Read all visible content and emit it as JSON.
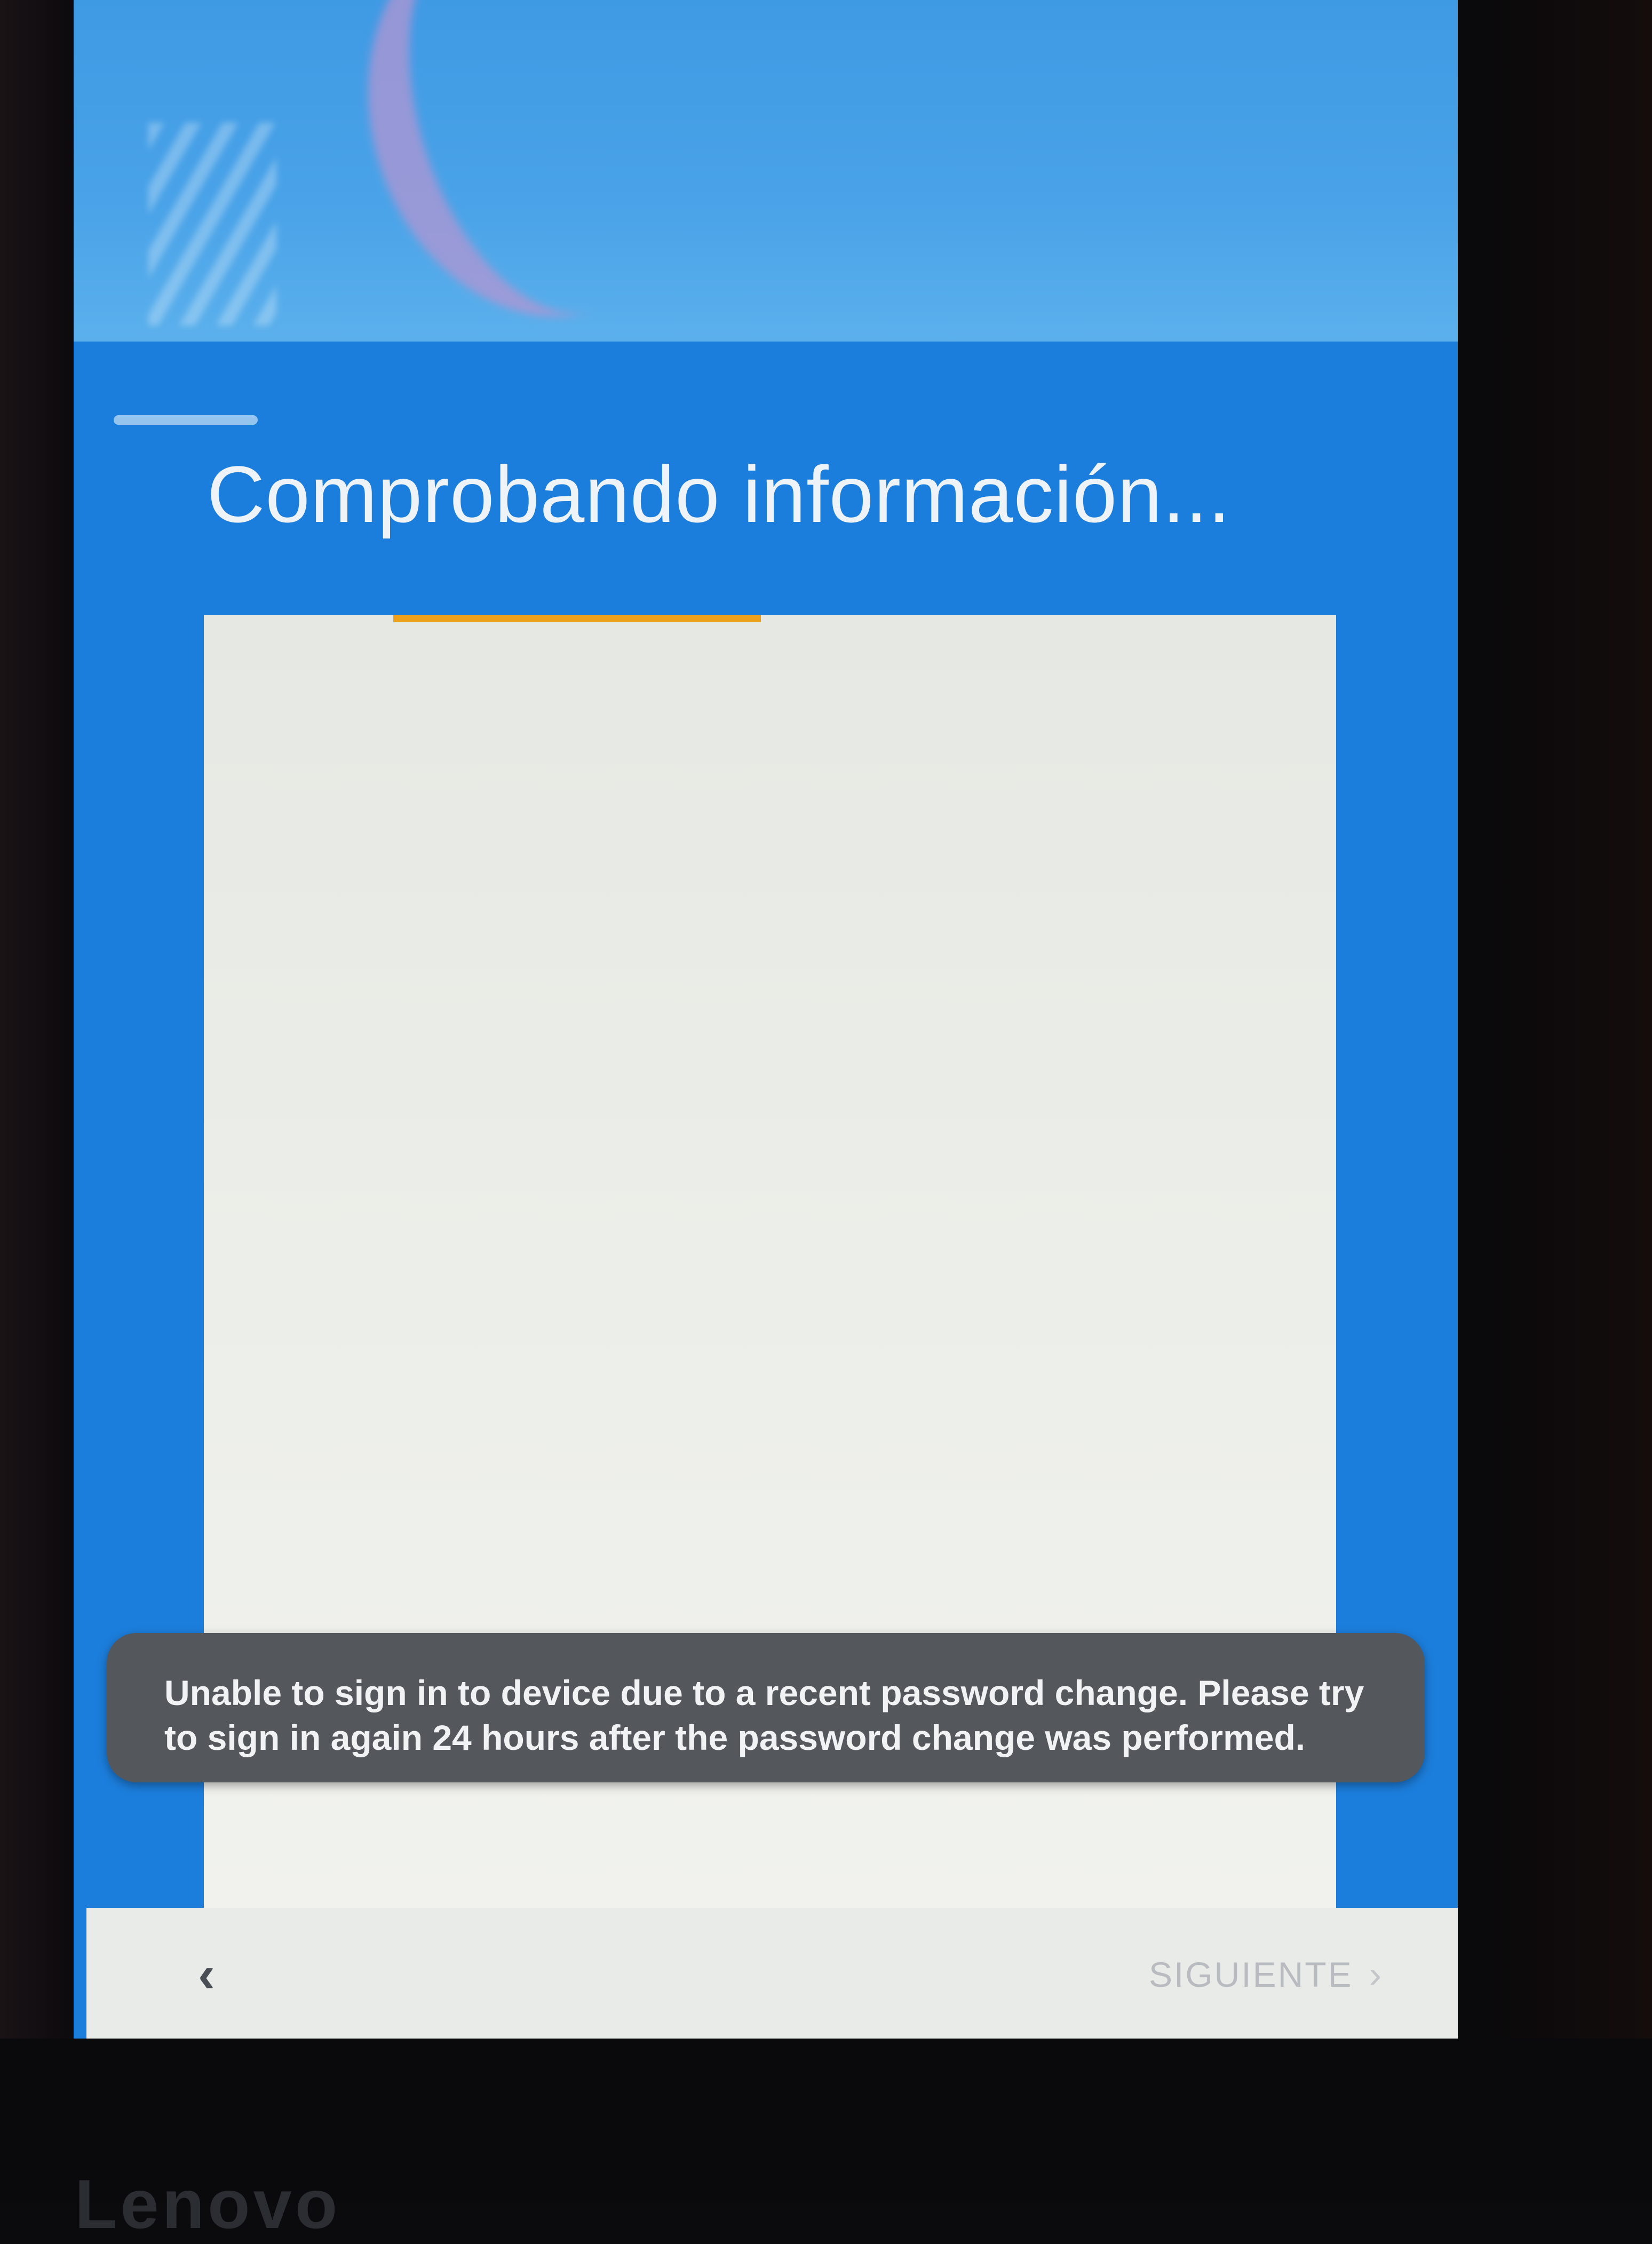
{
  "setup": {
    "title": "Comprobando información...",
    "progress_fraction": 0.39
  },
  "toast": {
    "message": "Unable to sign in to device due to a recent password change. Please try to sign in again 24 hours after the password change was performed."
  },
  "navigation": {
    "back_icon_glyph": "‹",
    "next_label": "SIGUIENTE",
    "next_icon_glyph": "›"
  },
  "device": {
    "brand": "Lenovo"
  },
  "icons": {
    "back": "chevron-left-icon",
    "next": "chevron-right-icon"
  },
  "colors": {
    "header_blue": "#1c7edc",
    "progress_accent": "#f0a11b",
    "toast_background": "#54585d",
    "card_background": "#eceee9"
  }
}
